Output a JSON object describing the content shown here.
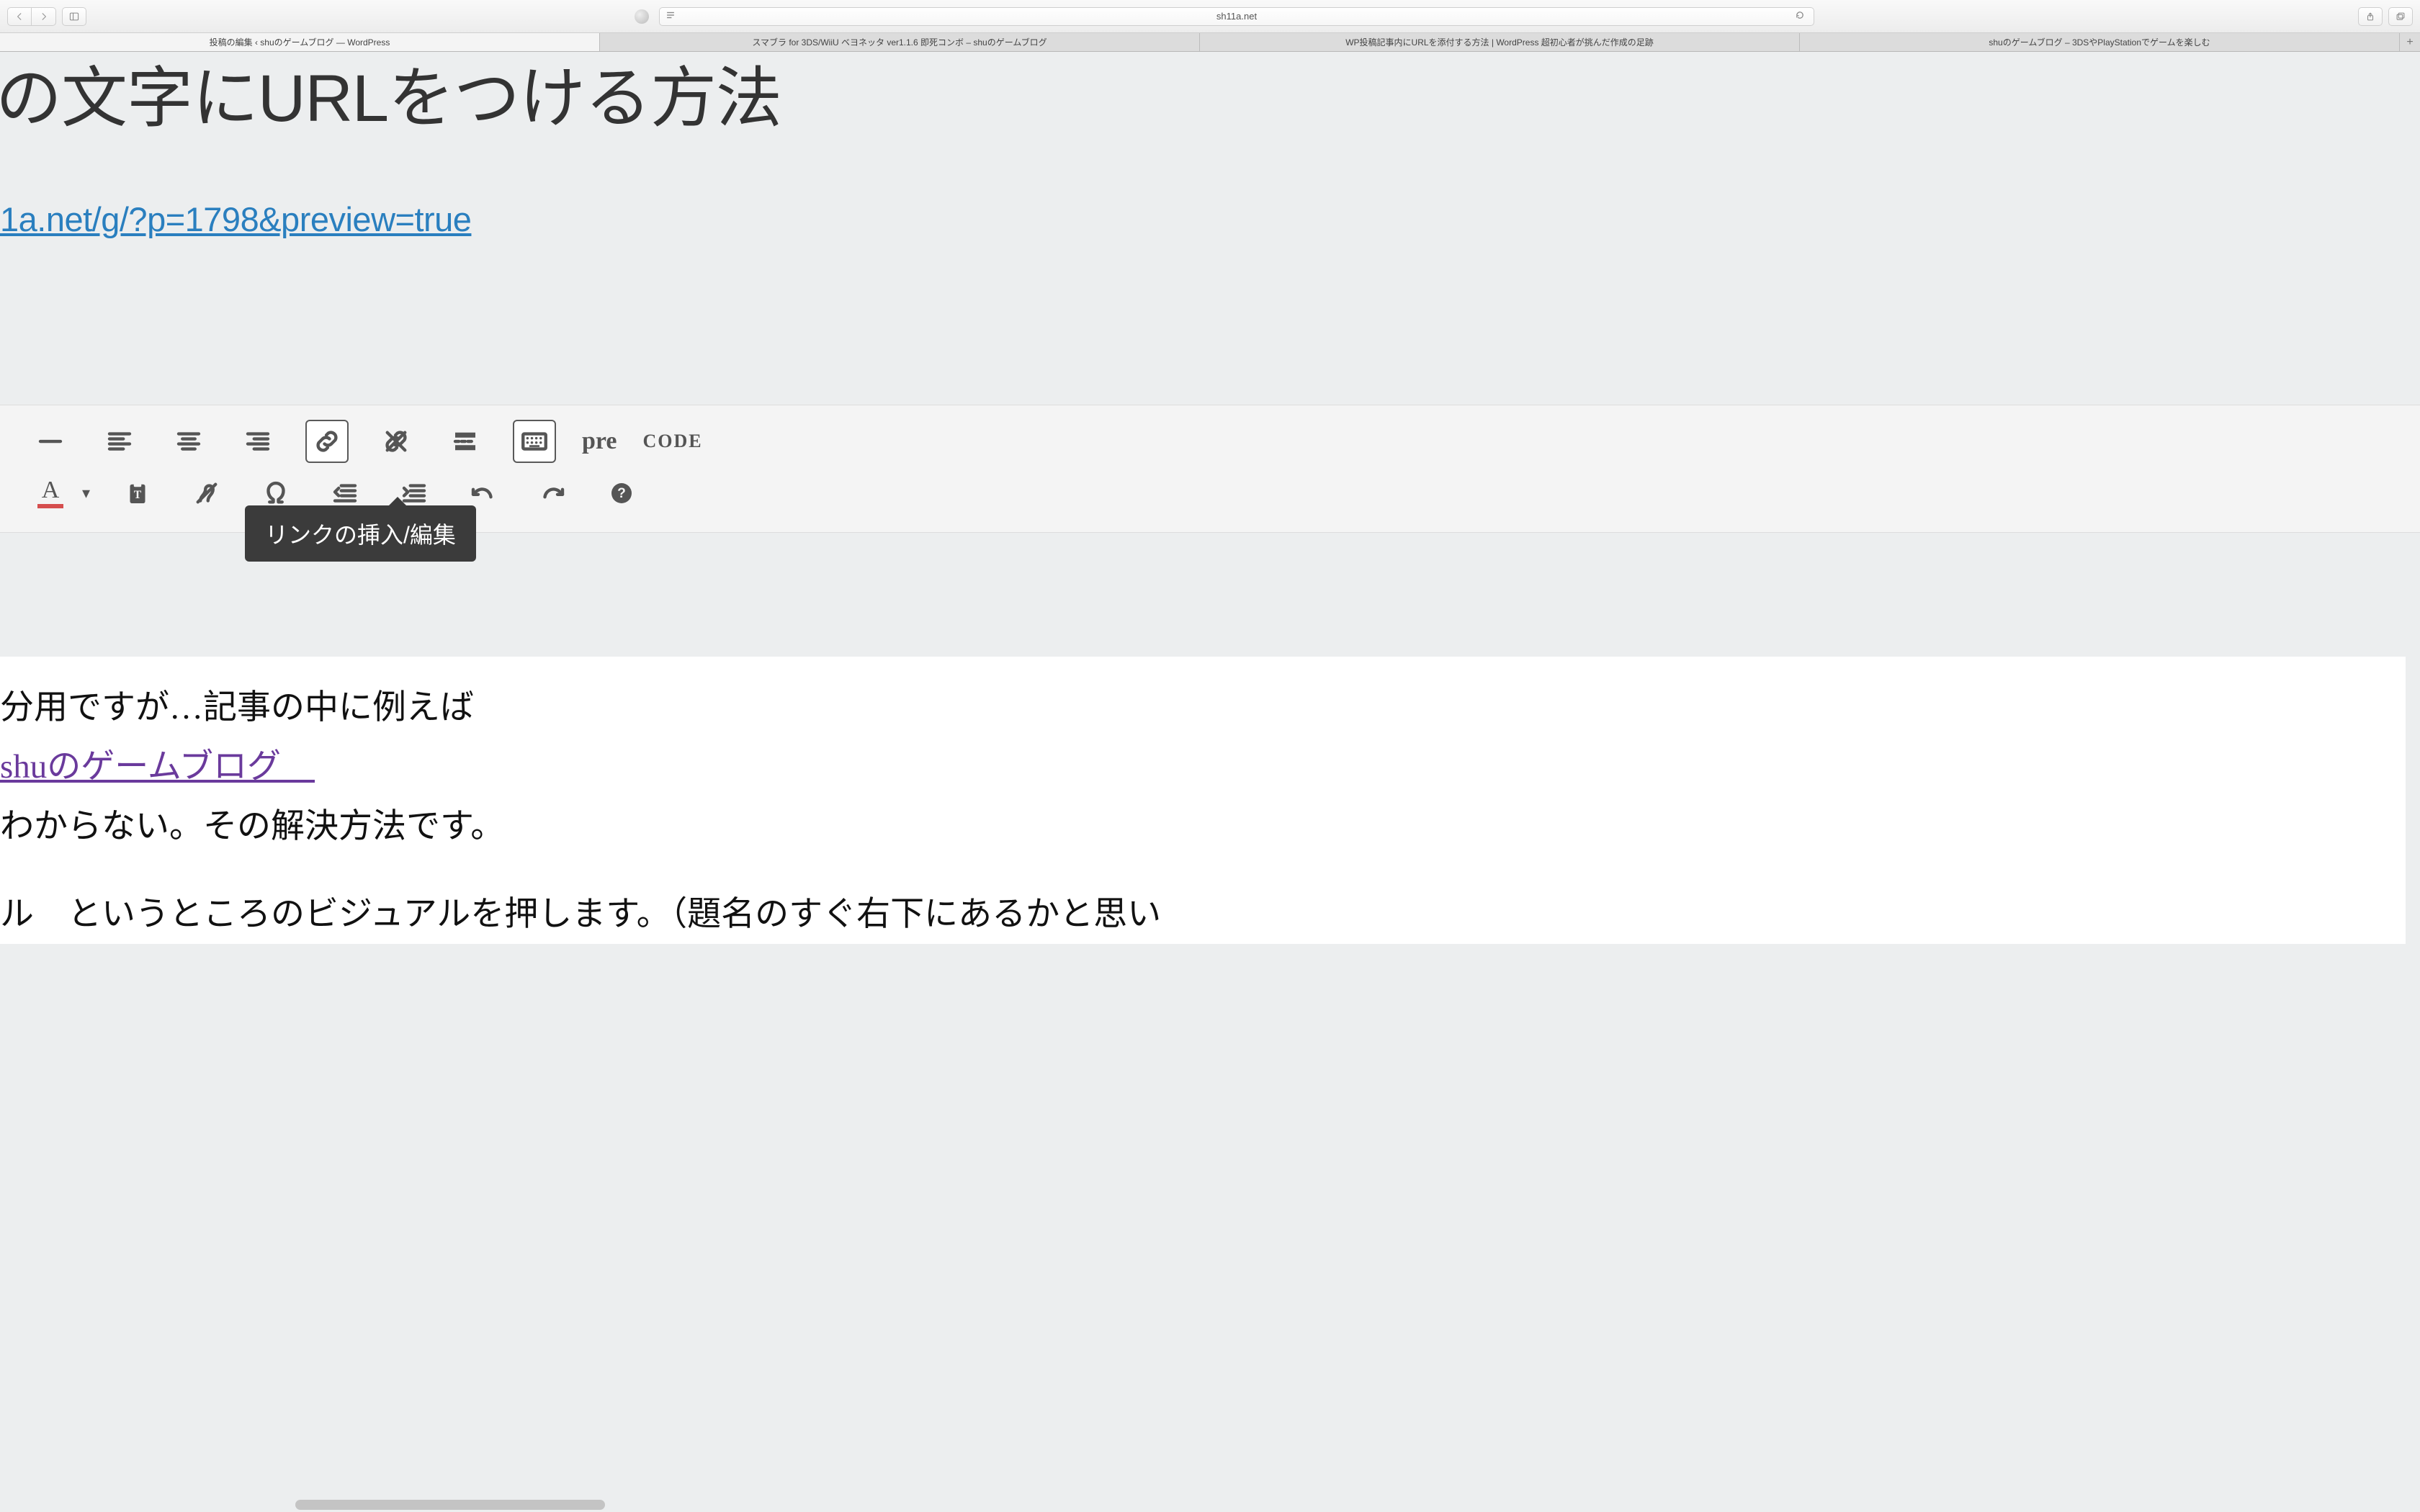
{
  "browser": {
    "address": "sh11a.net"
  },
  "tabs": [
    {
      "label": "投稿の編集 ‹ shuのゲームブログ — WordPress",
      "active": true
    },
    {
      "label": "スマブラ for 3DS/WiiU ベヨネッタ ver1.1.6 即死コンボ – shuのゲームブログ",
      "active": false
    },
    {
      "label": "WP投稿記事内にURLを添付する方法 | WordPress 超初心者が挑んだ作成の足跡",
      "active": false
    },
    {
      "label": "shuのゲームブログ – 3DSやPlayStationでゲームを楽しむ",
      "active": false
    }
  ],
  "page": {
    "title_fragment": "の文字にURLをつける方法",
    "preview_url": "1a.net/g/?p=1798&preview=true",
    "tooltip": "リンクの挿入/編集",
    "toolbar": {
      "pre": "pre",
      "code": "CODE",
      "textcolor": "A"
    },
    "body": {
      "line1": "分用ですが…記事の中に例えば",
      "link_text": "shuのゲームブログ　",
      "line2": "わからない。その解決方法です。",
      "line3": "ル　というところのビジュアルを押します。（題名のすぐ右下にあるかと思い"
    }
  }
}
